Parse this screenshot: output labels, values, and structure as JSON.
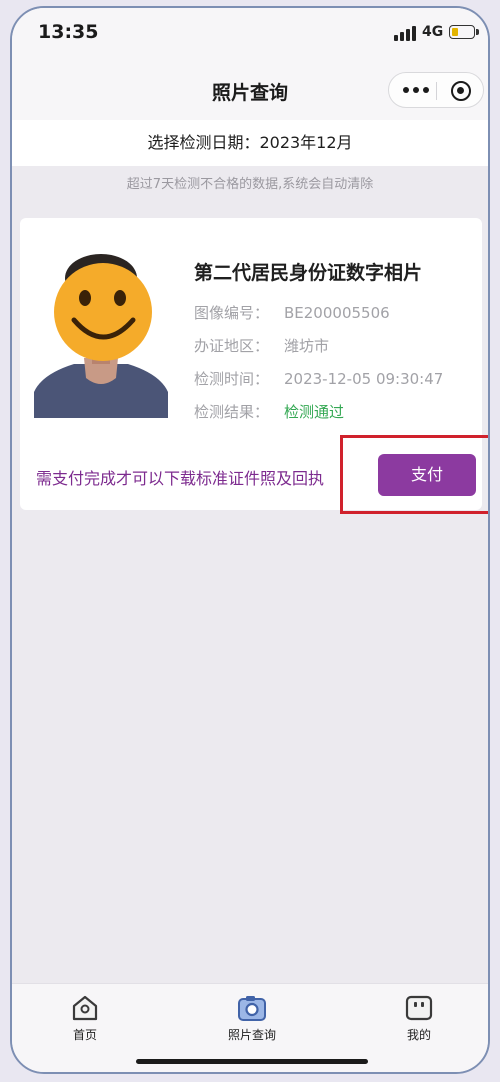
{
  "status_bar": {
    "time": "13:35",
    "network": "4G",
    "battery_level": 0.3
  },
  "nav": {
    "title": "照片查询",
    "more_icon": "more-dots-icon",
    "close_icon": "miniprogram-close-icon"
  },
  "date_selector": {
    "label": "选择检测日期：",
    "value": "2023年12月"
  },
  "notice": "超过7天检测不合格的数据,系统会自动清除",
  "record": {
    "title": "第二代居民身份证数字相片",
    "fields": [
      {
        "label": "图像编号：",
        "value": "BE200005506"
      },
      {
        "label": "办证地区：",
        "value": "潍坊市"
      },
      {
        "label": "检测时间：",
        "value": "2023-12-05 09:30:47"
      },
      {
        "label": "检测结果：",
        "value": "检测通过"
      }
    ],
    "pay_notice": "需支付完成才可以下载标准证件照及回执",
    "pay_button": "支付"
  },
  "tabs": [
    {
      "label": "首页",
      "icon": "home-icon"
    },
    {
      "label": "照片查询",
      "icon": "camera-icon"
    },
    {
      "label": "我的",
      "icon": "profile-icon"
    }
  ],
  "colors": {
    "accent": "#8c3aa0",
    "pay_notice": "#7d2b8f",
    "pass": "#34a853",
    "highlight": "#d0212c"
  }
}
